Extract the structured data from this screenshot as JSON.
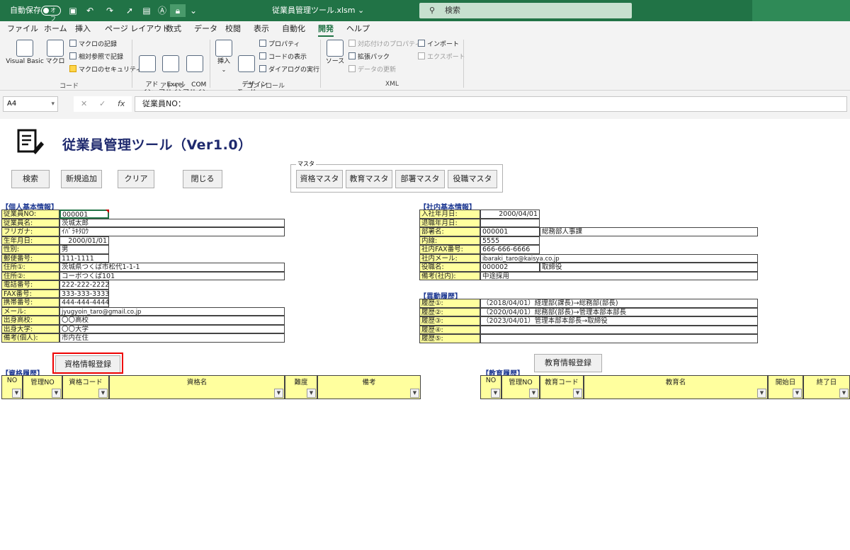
{
  "titlebar": {
    "autosave_label": "自動保存",
    "autosave_state": "オフ",
    "filename": "従業員管理ツール.xlsm ⌄",
    "search_placeholder": "検索"
  },
  "menu": [
    "ファイル",
    "ホーム",
    "挿入",
    "ページ レイアウト",
    "数式",
    "データ",
    "校閲",
    "表示",
    "自動化",
    "開発",
    "ヘルプ"
  ],
  "active_menu": "開発",
  "ribbon": {
    "code": {
      "label": "コード",
      "visual_basic": "Visual Basic",
      "macro": "マクロ",
      "record_macro": "マクロの記録",
      "relative_ref": "相対参照で記録",
      "macro_security": "マクロのセキュリティ"
    },
    "addin": {
      "label": "アドイン",
      "addin": "アド\nイン",
      "excel_addin": "Excel\nアドイン",
      "com_addin": "COM\nアドイン"
    },
    "control": {
      "label": "コントロール",
      "insert": "挿入",
      "design_mode": "デザイン\nモード",
      "properties": "プロパティ",
      "view_code": "コードの表示",
      "run_dialog": "ダイアログの実行"
    },
    "xml": {
      "label": "XML",
      "source": "ソース",
      "map_props": "対応付けのプロパティ",
      "expansion_pack": "拡張パック",
      "refresh_data": "データの更新",
      "import": "インポート",
      "export": "エクスポート"
    }
  },
  "formula": {
    "cell_ref": "A4",
    "cancel": "✕",
    "enter": "✓",
    "fx": "fx",
    "content": "従業員NO："
  },
  "sheet": {
    "title": "従業員管理ツール（Ver1.0）",
    "buttons": {
      "search": "検索",
      "add_new": "新規追加",
      "clear": "クリア",
      "close": "閉じる"
    },
    "master_group_label": "マスタ",
    "master_buttons": [
      "資格マスタ",
      "教育マスタ",
      "部署マスタ",
      "役職マスタ"
    ],
    "personal_head": "【個人基本情報】",
    "personal": [
      {
        "label": "従業員NO:",
        "value": "000001"
      },
      {
        "label": "従業員名:",
        "value": "茨城太郎"
      },
      {
        "label": "フリガナ:",
        "value": "ｲﾊﾞﾗｷﾀﾛｳ"
      },
      {
        "label": "生年月日:",
        "value": "2000/01/01"
      },
      {
        "label": "性別:",
        "value": "男"
      },
      {
        "label": "郵便番号:",
        "value": "111-1111"
      },
      {
        "label": "住所①:",
        "value": "茨城県つくば市松代1-1-1"
      },
      {
        "label": "住所②:",
        "value": "コーポつくば101"
      },
      {
        "label": "電話番号:",
        "value": "222-222-2222"
      },
      {
        "label": "FAX番号:",
        "value": "333-333-3333"
      },
      {
        "label": "携帯番号:",
        "value": "444-444-4444"
      },
      {
        "label": "メール:",
        "value": "jyugyoin_taro@gmail.co.jp"
      },
      {
        "label": "出身高校:",
        "value": "〇〇高校"
      },
      {
        "label": "出身大学:",
        "value": "〇〇大学"
      },
      {
        "label": "備考(個人):",
        "value": "市内在住"
      }
    ],
    "company_head": "【社内基本情報】",
    "company": [
      {
        "label": "入社年月日:",
        "value": "2000/04/01",
        "value2": ""
      },
      {
        "label": "退職年月日:",
        "value": "",
        "value2": ""
      },
      {
        "label": "部署名:",
        "value": "000001",
        "value2": "総務部人事課"
      },
      {
        "label": "内線:",
        "value": "5555",
        "value2": ""
      },
      {
        "label": "社内FAX番号:",
        "value": "666-666-6666",
        "value2": ""
      },
      {
        "label": "社内メール:",
        "value": "ibaraki_taro@kaisya.co.jp",
        "value2": ""
      },
      {
        "label": "役職名:",
        "value": "000002",
        "value2": "取締役"
      },
      {
        "label": "備考(社内):",
        "value": "中途採用",
        "value2": ""
      }
    ],
    "transfer_head": "【異動履歴】",
    "transfers": [
      {
        "label": "履歴①:",
        "value": "（2018/04/01）経理部(課長)→総務部(部長)"
      },
      {
        "label": "履歴②:",
        "value": "（2020/04/01）総務部(部長)→管理本部本部長"
      },
      {
        "label": "履歴③:",
        "value": "（2023/04/01）管理本部本部長→取締役"
      },
      {
        "label": "履歴④:",
        "value": ""
      },
      {
        "label": "履歴⑤:",
        "value": ""
      }
    ],
    "qual_button": "資格情報登録",
    "edu_button": "教育情報登録",
    "qual_head": "【資格履歴】",
    "qual_columns": [
      "NO",
      "管理NO",
      "資格コード",
      "資格名",
      "難度",
      "備考"
    ],
    "edu_head": "【教育履歴】",
    "edu_columns": [
      "NO",
      "管理NO",
      "教育コード",
      "教育名",
      "開始日",
      "終了日"
    ]
  }
}
